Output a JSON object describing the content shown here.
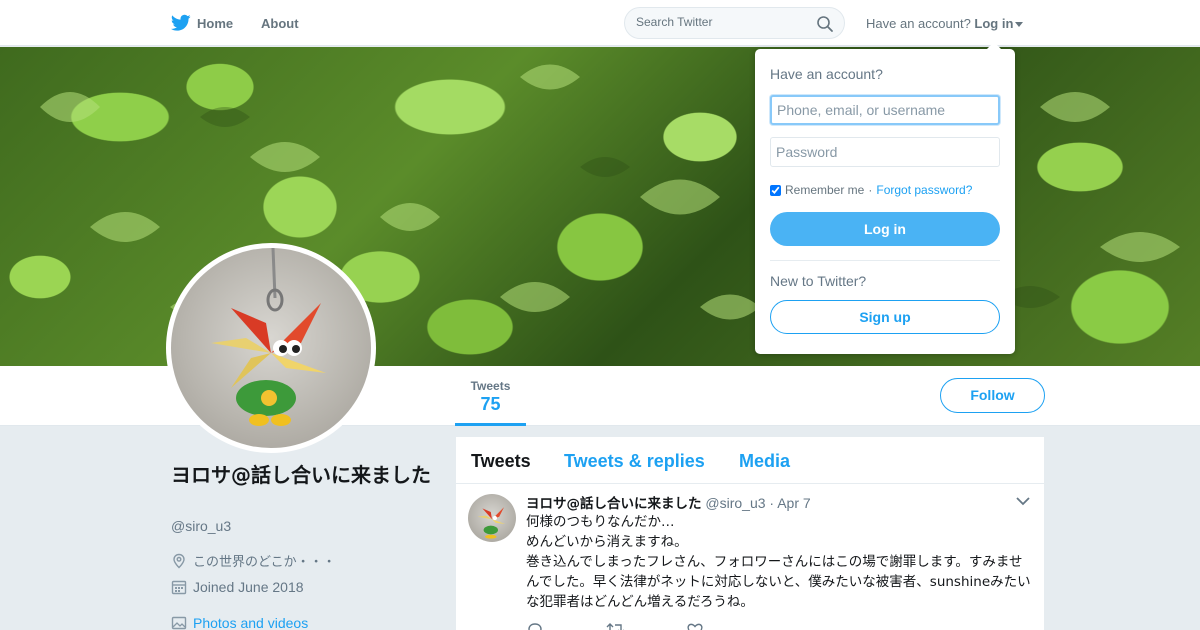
{
  "nav": {
    "home_label": "Home",
    "about_label": "About",
    "search_placeholder": "Search Twitter",
    "have_account": "Have an account?",
    "login_label": "Log in"
  },
  "profile": {
    "display_name": "ヨロサ@話し合いに来ました",
    "handle": "@siro_u3",
    "location": "この世界のどこか・・・",
    "joined": "Joined June 2018",
    "photos_link": "Photos and videos",
    "follow_label": "Follow",
    "stats": {
      "tweets_label": "Tweets",
      "tweets_value": "75"
    }
  },
  "timeline": {
    "tabs": [
      {
        "label": "Tweets"
      },
      {
        "label": "Tweets & replies"
      },
      {
        "label": "Media"
      }
    ],
    "tweet": {
      "name": "ヨロサ@話し合いに来ました",
      "handle": "@siro_u3",
      "separator": "·",
      "date": "Apr 7",
      "lines": [
        "何様のつもりなんだか…",
        "めんどいから消えますね。",
        "巻き込んでしまったフレさん、フォロワーさんにはこの場で謝罪します。すみませんでした。早く法律がネットに対応しないと、僕みたいな被害者、sunshineみたいな犯罪者はどんどん増えるだろうね。"
      ]
    }
  },
  "login_dropdown": {
    "title": "Have an account?",
    "username_placeholder": "Phone, email, or username",
    "password_placeholder": "Password",
    "remember_label": "Remember me",
    "separator": "·",
    "forgot_label": "Forgot password?",
    "login_button": "Log in",
    "new_label": "New to Twitter?",
    "signup_button": "Sign up"
  },
  "colors": {
    "accent": "#1da1f2",
    "background": "#e6ecf0"
  }
}
